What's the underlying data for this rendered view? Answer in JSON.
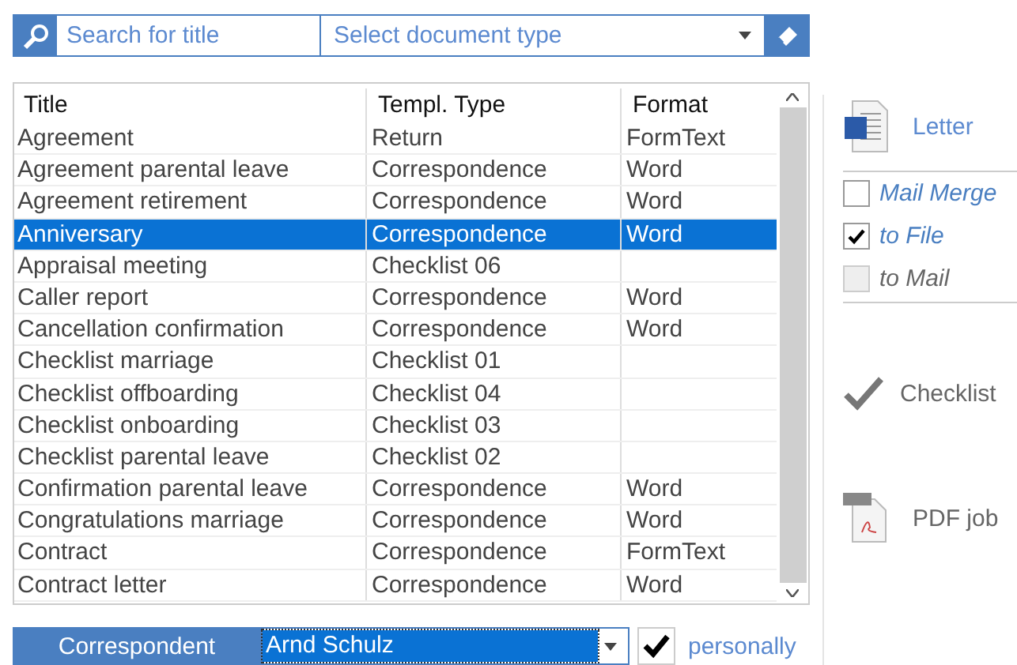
{
  "search": {
    "placeholder": "Search for title"
  },
  "doc_type": {
    "placeholder": "Select document type"
  },
  "table": {
    "columns": [
      "Title",
      "Templ. Type",
      "Format"
    ],
    "rows": [
      {
        "cells": [
          "Agreement",
          "Return",
          "FormText"
        ],
        "selected": false
      },
      {
        "cells": [
          "Agreement parental leave",
          "Correspondence",
          "Word"
        ],
        "selected": false
      },
      {
        "cells": [
          "Agreement retirement",
          "Correspondence",
          "Word"
        ],
        "selected": false
      },
      {
        "cells": [
          "Anniversary",
          "Correspondence",
          "Word"
        ],
        "selected": true
      },
      {
        "cells": [
          "Appraisal meeting",
          "Checklist 06",
          ""
        ],
        "selected": false
      },
      {
        "cells": [
          "Caller report",
          "Correspondence",
          "Word"
        ],
        "selected": false
      },
      {
        "cells": [
          "Cancellation confirmation",
          "Correspondence",
          "Word"
        ],
        "selected": false
      },
      {
        "cells": [
          "Checklist marriage",
          "Checklist 01",
          ""
        ],
        "selected": false
      },
      {
        "cells": [
          "Checklist offboarding",
          "Checklist 04",
          ""
        ],
        "selected": false
      },
      {
        "cells": [
          "Checklist onboarding",
          "Checklist 03",
          ""
        ],
        "selected": false
      },
      {
        "cells": [
          "Checklist parental leave",
          "Checklist 02",
          ""
        ],
        "selected": false
      },
      {
        "cells": [
          "Confirmation parental leave",
          "Correspondence",
          "Word"
        ],
        "selected": false
      },
      {
        "cells": [
          "Congratulations marriage",
          "Correspondence",
          "Word"
        ],
        "selected": false
      },
      {
        "cells": [
          "Contract",
          "Correspondence",
          "FormText"
        ],
        "selected": false
      },
      {
        "cells": [
          "Contract letter",
          "Correspondence",
          "Word"
        ],
        "selected": false
      }
    ]
  },
  "actions": {
    "letter": "Letter",
    "options": [
      {
        "label": "Mail Merge",
        "checked": false,
        "disabled": false
      },
      {
        "label": "to File",
        "checked": true,
        "disabled": false
      },
      {
        "label": "to Mail",
        "checked": false,
        "disabled": true
      }
    ],
    "checklist": "Checklist",
    "pdf": "PDF job"
  },
  "footer": {
    "label": "Correspondent",
    "value": "Arnd Schulz",
    "personally": {
      "label": "personally",
      "checked": true
    }
  }
}
